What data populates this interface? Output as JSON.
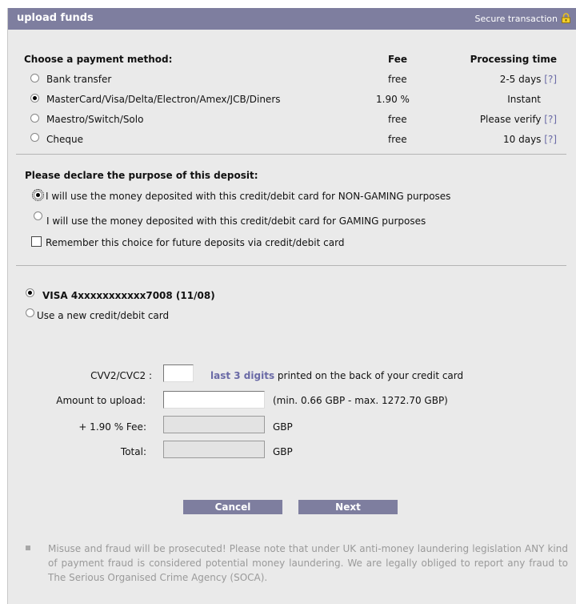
{
  "header": {
    "title": "upload funds",
    "secure": "Secure transaction"
  },
  "payment": {
    "heading": "Choose a payment method:",
    "fee_header": "Fee",
    "time_header": "Processing time",
    "methods": [
      {
        "label": "Bank transfer",
        "fee": "free",
        "time": "2-5 days",
        "help": "[?]",
        "selected": false
      },
      {
        "label": "MasterCard/Visa/Delta/Electron/Amex/JCB/Diners",
        "fee": "1.90 %",
        "time": "Instant",
        "help": "",
        "selected": true
      },
      {
        "label": "Maestro/Switch/Solo",
        "fee": "free",
        "time": "Please verify",
        "help": "[?]",
        "selected": false
      },
      {
        "label": "Cheque",
        "fee": "free",
        "time": "10 days",
        "help": "[?]",
        "selected": false
      }
    ]
  },
  "purpose": {
    "heading": "Please declare the purpose of this deposit:",
    "non_gaming": "I will use the money deposited with this credit/debit card for NON-GAMING purposes",
    "gaming": "I will use the money deposited with this credit/debit card for GAMING purposes",
    "remember": "Remember this choice for future deposits via credit/debit card"
  },
  "card": {
    "saved": "VISA 4xxxxxxxxxxx7008 (11/08)",
    "new_card": "Use a new credit/debit card"
  },
  "form": {
    "cvv_label": "CVV2/CVC2 :",
    "cvv_link": "last 3 digits",
    "cvv_hint": "printed on the back of your credit card",
    "amount_label": "Amount to upload:",
    "amount_hint": "(min. 0.66 GBP - max. 1272.70 GBP)",
    "fee_label": "+ 1.90 % Fee:",
    "fee_unit": "GBP",
    "total_label": "Total:",
    "total_unit": "GBP"
  },
  "buttons": {
    "cancel": "Cancel",
    "next": "Next"
  },
  "notice": "Misuse and fraud will be prosecuted! Please note that under UK anti-money laundering legislation ANY kind of payment fraud is considered potential money laundering. We are legally obliged to report any fraud to The Serious Organised Crime Agency (SOCA).",
  "colors": {
    "header_bg": "#7e7e9f",
    "panel_bg": "#eaeaea",
    "link": "#6a6aa6",
    "notice": "#9a9a9a"
  }
}
